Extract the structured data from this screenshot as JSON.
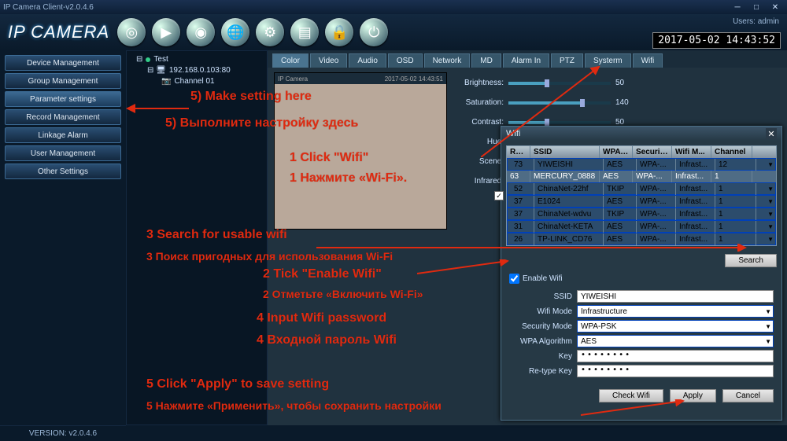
{
  "window": {
    "title": "IP Camera Client-v2.0.4.6"
  },
  "header": {
    "logo": "IP CAMERA",
    "user_label": "Users:",
    "user_name": "admin",
    "clock": "2017-05-02 14:43:52"
  },
  "sidebar": [
    "Device Management",
    "Group Management",
    "Parameter settings",
    "Record Management",
    "Linkage Alarm",
    "User Management",
    "Other Settings"
  ],
  "tree": {
    "root": "Test",
    "ip": "192.168.0.103:80",
    "channel": "Channel 01"
  },
  "tabs": [
    "Color",
    "Video",
    "Audio",
    "OSD",
    "Network",
    "MD",
    "Alarm In",
    "PTZ",
    "Systerm",
    "Wifi"
  ],
  "preview": {
    "name": "IP Camera",
    "ts": "2017-05-02 14:43:51"
  },
  "sliders": {
    "brightness": {
      "label": "Brightness:",
      "value": 50
    },
    "saturation": {
      "label": "Saturation:",
      "value": 140
    },
    "contrast": {
      "label": "Contrast:",
      "value": 50
    },
    "hue": {
      "label": "Hue:",
      "value": ""
    },
    "scene": {
      "label": "Scene:",
      "value": ""
    },
    "infrared": {
      "label": "Infrared:",
      "value": ""
    }
  },
  "wifi": {
    "title": "Wifi",
    "columns": [
      "RSSI",
      "SSID",
      "WPA A...",
      "Securit...",
      "Wifi M...",
      "Channel"
    ],
    "rows": [
      {
        "rssi": "73",
        "ssid": "YIWEISHI",
        "wpa": "AES",
        "sec": "WPA-...",
        "mode": "Infrast...",
        "chan": "12"
      },
      {
        "rssi": "63",
        "ssid": "MERCURY_0888",
        "wpa": "AES",
        "sec": "WPA-...",
        "mode": "Infrast...",
        "chan": "1"
      },
      {
        "rssi": "52",
        "ssid": "ChinaNet-22hf",
        "wpa": "TKIP",
        "sec": "WPA-...",
        "mode": "Infrast...",
        "chan": "1"
      },
      {
        "rssi": "37",
        "ssid": "E1024",
        "wpa": "AES",
        "sec": "WPA-...",
        "mode": "Infrast...",
        "chan": "1"
      },
      {
        "rssi": "37",
        "ssid": "ChinaNet-wdvu",
        "wpa": "TKIP",
        "sec": "WPA-...",
        "mode": "Infrast...",
        "chan": "1"
      },
      {
        "rssi": "31",
        "ssid": "ChinaNet-KETA",
        "wpa": "AES",
        "sec": "WPA-...",
        "mode": "Infrast...",
        "chan": "1"
      },
      {
        "rssi": "26",
        "ssid": "TP-LINK_CD76",
        "wpa": "AES",
        "sec": "WPA-...",
        "mode": "Infrast...",
        "chan": "1"
      }
    ],
    "search_btn": "Search",
    "enable_label": "Enable Wifi",
    "enable_checked": true,
    "form": {
      "ssid_label": "SSID",
      "ssid_value": "YIWEISHI",
      "mode_label": "Wifi Mode",
      "mode_value": "Infrastructure",
      "sec_label": "Security Mode",
      "sec_value": "WPA-PSK",
      "algo_label": "WPA Algorithm",
      "algo_value": "AES",
      "key_label": "Key",
      "key_value": "••••••••",
      "rekey_label": "Re-type Key",
      "rekey_value": "••••••••"
    },
    "buttons": {
      "check": "Check Wifi",
      "apply": "Apply",
      "cancel": "Cancel"
    }
  },
  "footer": {
    "version_label": "VERSION: v2.0.4.6"
  },
  "annotations": {
    "a5a": "5) Make setting here",
    "a5b": "5) Выполните настройку здесь",
    "a1a": "1 Click \"Wifi\"",
    "a1b": "1 Нажмите «Wi-Fi».",
    "a3a": "3 Search for usable wifi",
    "a3b": "3 Поиск пригодных для использования Wi-Fi",
    "a2a": "2 Tick \"Enable Wifi\"",
    "a2b": "2 Отметьте «Включить Wi-Fi»",
    "a4a": "4 Input Wifi password",
    "a4b": "4 Входной пароль Wifi",
    "a6a": "5 Click \"Apply\" to save setting",
    "a6b": "5 Нажмите «Применить», чтобы сохранить настройки"
  }
}
